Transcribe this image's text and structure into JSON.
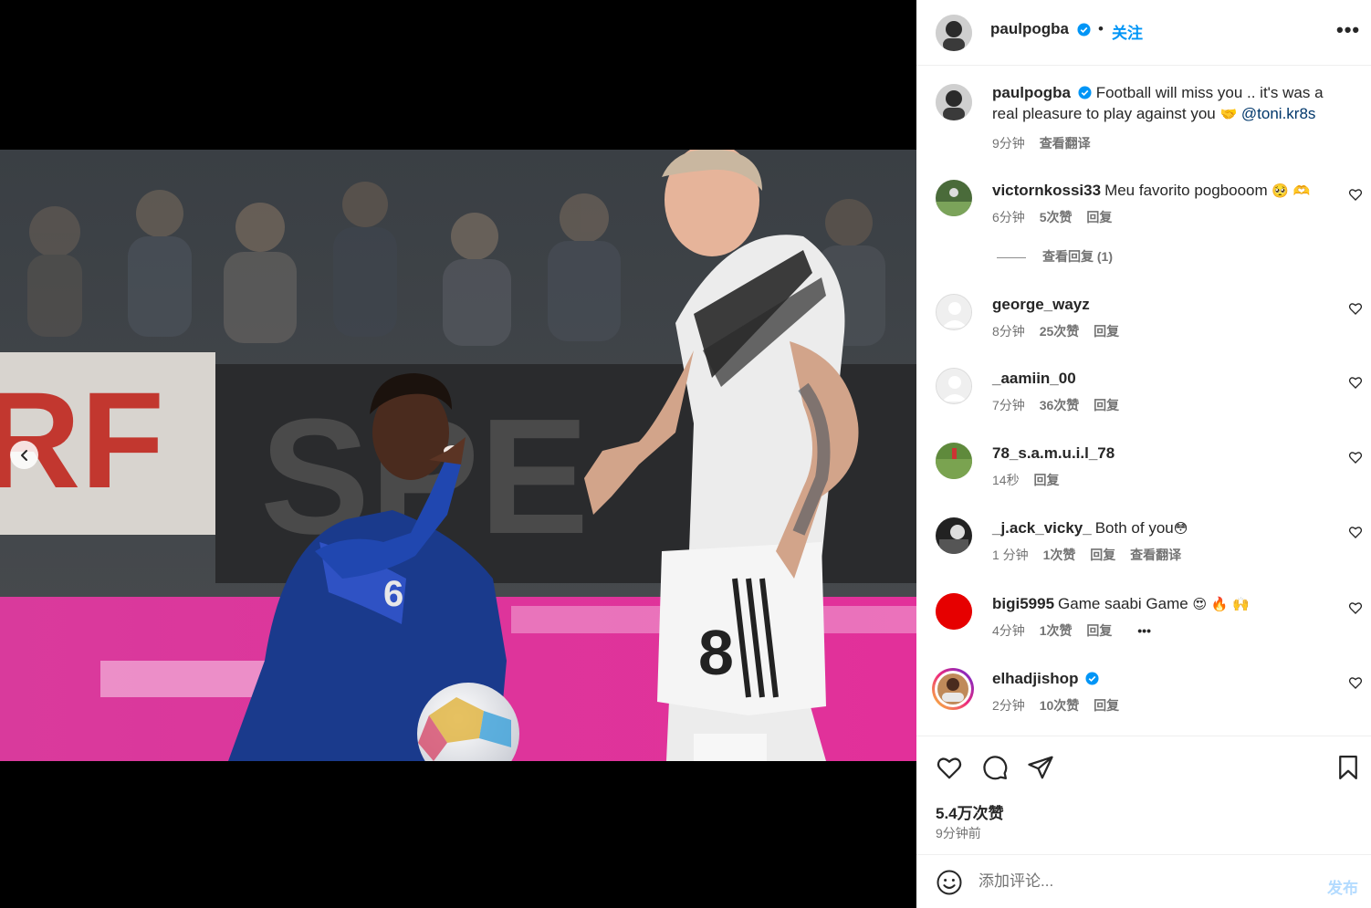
{
  "post": {
    "author": "paulpogba",
    "follow_label": "关注",
    "separator": "•",
    "more_label": "•••",
    "caption_text": "Football will miss you .. it's was a real pleasure to play against you",
    "caption_emoji": "🤝",
    "caption_mention": "@toni.kr8s",
    "caption_time": "9分钟",
    "caption_translate": "查看翻译"
  },
  "comments": [
    {
      "username": "victornkossi33",
      "text": "Meu favorito pogbooom",
      "emoji": "🥺 🫶",
      "time": "6分钟",
      "likes": "5次赞",
      "reply": "回复",
      "avatar_color": "#4a6b3a"
    },
    {
      "username": "george_wayz",
      "text": "",
      "emoji": "",
      "time": "8分钟",
      "likes": "25次赞",
      "reply": "回复",
      "avatar_color": "#dbdbdb"
    },
    {
      "username": "_aamiin_00",
      "text": "",
      "emoji": "",
      "time": "7分钟",
      "likes": "36次赞",
      "reply": "回复",
      "avatar_color": "#dbdbdb"
    },
    {
      "username": "78_s.a.m.u.i.l_78",
      "text": "",
      "emoji": "",
      "time": "14秒",
      "likes": "",
      "reply": "回复",
      "avatar_color": "#5f8a3c"
    },
    {
      "username": "_j.ack_vicky_",
      "text": "Both of you",
      "emoji": "😳",
      "time": "1 分钟",
      "likes": "1次赞",
      "reply": "回复",
      "translate": "查看翻译",
      "avatar_color": "#222222"
    },
    {
      "username": "bigi5995",
      "text": "Game saabi Game",
      "emoji": "😍 🔥 🙌",
      "time": "4分钟",
      "likes": "1次赞",
      "reply": "回复",
      "more": "•••",
      "avatar_color": "#e60000"
    },
    {
      "username": "elhadjishop",
      "text": "",
      "emoji": "",
      "time": "2分钟",
      "likes": "10次赞",
      "reply": "回复",
      "avatar_color": "#c08a5a"
    }
  ],
  "view_replies": "查看回复 (1)",
  "likes_total": "5.4万次赞",
  "post_time": "9分钟前",
  "composer": {
    "placeholder": "添加评论...",
    "post_label": "发布"
  },
  "colors": {
    "accent": "#0095f6",
    "verified": "#0095f6",
    "muted": "#737373",
    "post_disabled": "#b3dbff"
  },
  "icons": [
    "verified-badge-icon",
    "more-options-icon",
    "heart-icon",
    "comment-icon",
    "share-icon",
    "bookmark-icon",
    "emoji-icon",
    "chevron-left-icon"
  ]
}
